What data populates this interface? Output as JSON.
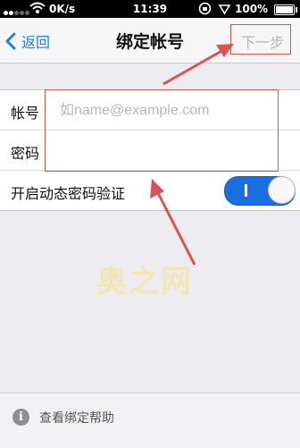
{
  "status_bar": {
    "carrier_speed": "0K/s",
    "time": "11:39",
    "battery": "100%",
    "signal_bars_filled": 2
  },
  "nav": {
    "back_label": "返回",
    "title": "绑定帐号",
    "next_label": "下一步"
  },
  "form": {
    "account_label": "帐号",
    "account_placeholder": "如name@example.com",
    "account_value": "",
    "password_label": "密码",
    "password_value": "",
    "dynamic_pw_label": "开启动态密码验证",
    "dynamic_pw_toggle": "I",
    "dynamic_pw_on": true
  },
  "watermark": "奥之网",
  "help": {
    "icon": "i",
    "label": "查看绑定帮助"
  },
  "colors": {
    "accent": "#1a7ef5",
    "toggle_on": "#1a6fe0",
    "annotation": "#d9534f"
  }
}
